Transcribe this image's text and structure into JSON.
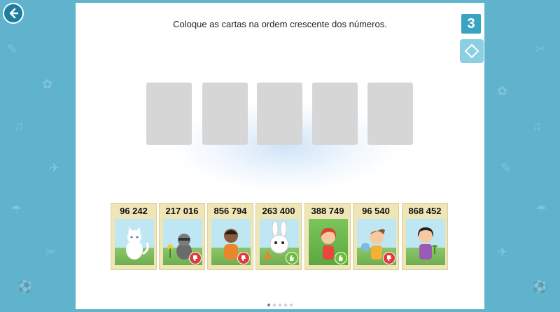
{
  "instruction": "Coloque as cartas na ordem crescente dos números.",
  "level_number": "3",
  "cards": [
    {
      "number": "96 242",
      "character": "white cat",
      "feedback": null
    },
    {
      "number": "217 016",
      "character": "raccoon with flower",
      "feedback": "thumbs-down"
    },
    {
      "number": "856 794",
      "character": "boy",
      "feedback": "thumbs-down"
    },
    {
      "number": "263 400",
      "character": "bunny",
      "feedback": "thumbs-up"
    },
    {
      "number": "388 749",
      "character": "red-haired girl",
      "feedback": "thumbs-up"
    },
    {
      "number": "96 540",
      "character": "girl painting",
      "feedback": "thumbs-down"
    },
    {
      "number": "868 452",
      "character": "girl with plant",
      "feedback": null
    }
  ],
  "empty_slots": 5,
  "pagination": {
    "total": 5,
    "current": 1
  },
  "colors": {
    "background": "#5fb3cc",
    "card": "#efe6b8",
    "slot": "#d6d6d6",
    "thumbs_up": "#6cbd3b",
    "thumbs_down": "#e13a3a"
  }
}
